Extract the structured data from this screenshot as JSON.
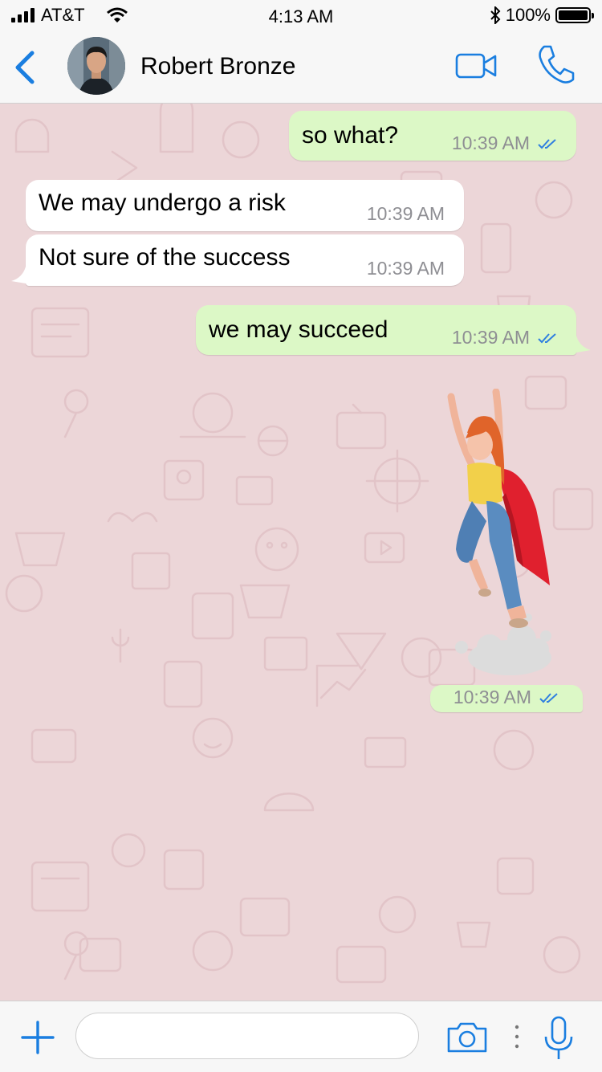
{
  "status_bar": {
    "carrier": "AT&T",
    "time": "4:13 AM",
    "battery": "100%"
  },
  "header": {
    "contact_name": "Robert Bronze"
  },
  "messages": [
    {
      "direction": "outgoing",
      "text": "so what?",
      "time": "10:39 AM",
      "status": "read"
    },
    {
      "direction": "incoming",
      "text": "We may undergo a risk",
      "time": "10:39 AM"
    },
    {
      "direction": "incoming",
      "text": "Not sure of the success",
      "time": "10:39 AM"
    },
    {
      "direction": "outgoing",
      "text": "we may succeed",
      "time": "10:39 AM",
      "status": "read"
    },
    {
      "direction": "outgoing",
      "type": "sticker",
      "sticker": "superhero-girl-flying",
      "time": "10:39 AM",
      "status": "read"
    }
  ],
  "input": {
    "placeholder": ""
  },
  "colors": {
    "accent": "#1a7ee0",
    "outgoing_bubble": "#dcf8c6",
    "incoming_bubble": "#ffffff",
    "wallpaper": "#ecd6d8",
    "read_ticks": "#2f7fe0"
  },
  "icons": [
    "back-chevron-icon",
    "video-camera-icon",
    "phone-icon",
    "plus-icon",
    "camera-icon",
    "more-dots-icon",
    "microphone-icon"
  ]
}
